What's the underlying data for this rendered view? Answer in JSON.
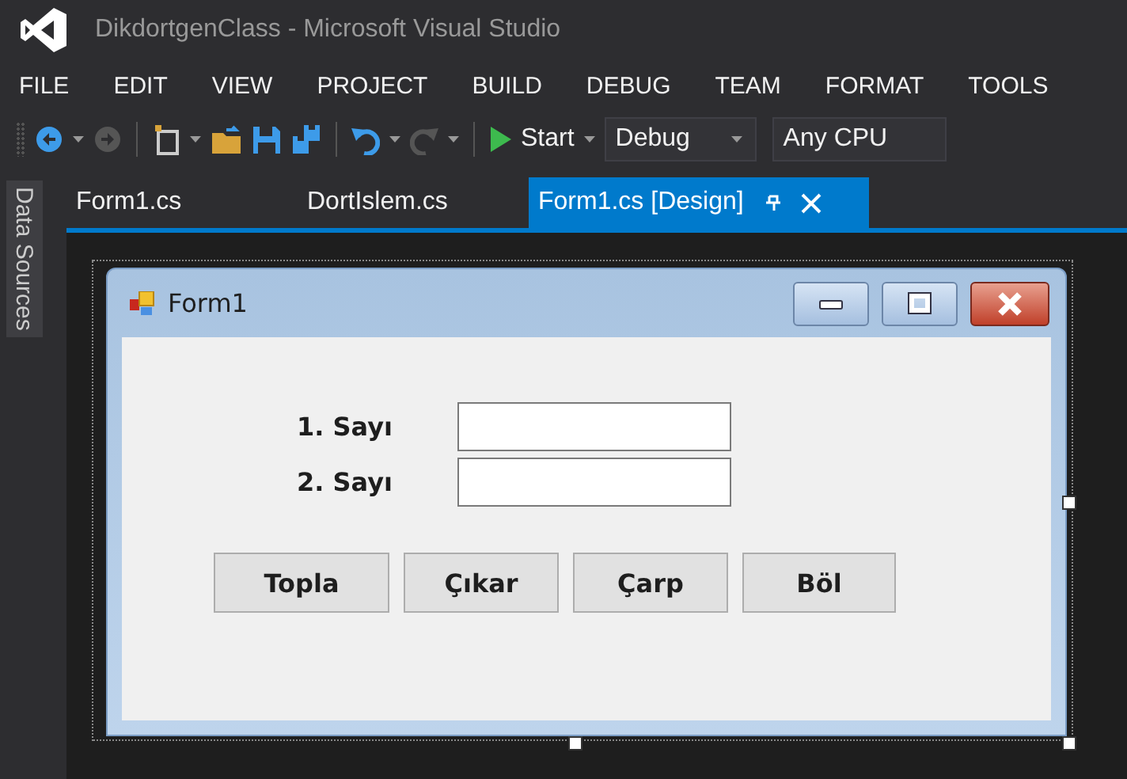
{
  "window": {
    "title": "DikdortgenClass - Microsoft Visual Studio"
  },
  "menu": [
    "FILE",
    "EDIT",
    "VIEW",
    "PROJECT",
    "BUILD",
    "DEBUG",
    "TEAM",
    "FORMAT",
    "TOOLS"
  ],
  "toolbar": {
    "start": "Start",
    "configuration": "Debug",
    "platform": "Any CPU"
  },
  "sidebar": {
    "label": "Data Sources"
  },
  "tabs": [
    {
      "label": "Form1.cs",
      "selected": false
    },
    {
      "label": "DortIslem.cs",
      "selected": false
    },
    {
      "label": "Form1.cs [Design]",
      "selected": true
    }
  ],
  "form": {
    "title": "Form1",
    "fields": [
      {
        "label": "1. Sayı"
      },
      {
        "label": "2. Sayı"
      }
    ],
    "buttons": [
      "Topla",
      "Çıkar",
      "Çarp",
      "Böl"
    ]
  }
}
